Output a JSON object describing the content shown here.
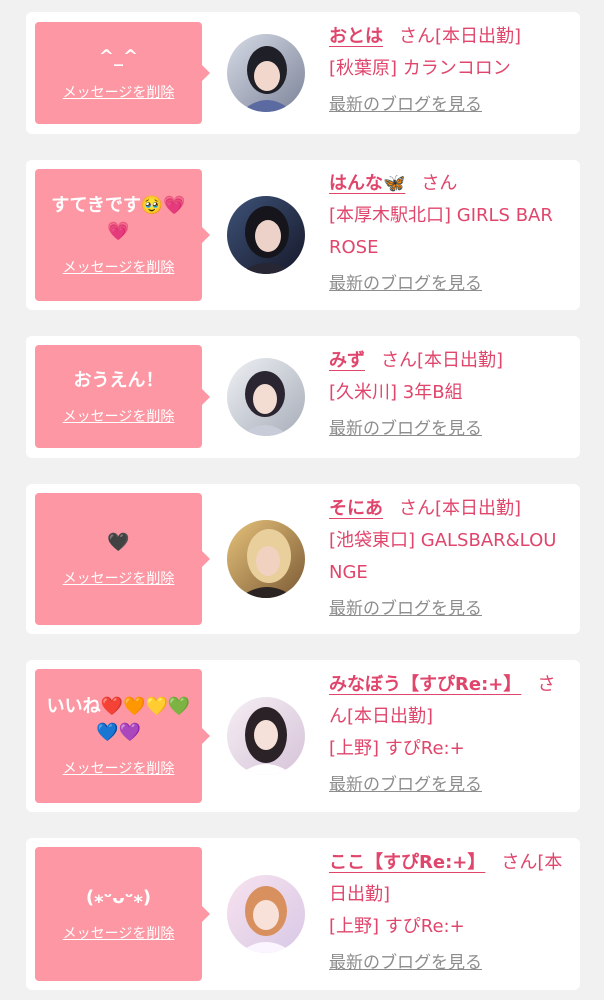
{
  "delete_label": "メッセージを削除",
  "blog_label": "最新のブログを見る",
  "honorific": "さん",
  "colors": {
    "accent": "#e0466c",
    "bubble": "#fd97a3",
    "link_gray": "#8d8d8d",
    "background": "#f1f1f1"
  },
  "entries": [
    {
      "message": "^_^",
      "name": "おとは",
      "status": "[本日出勤]",
      "shop": "[秋葉原] カランコロン"
    },
    {
      "message": "すてきです🥹💗💗",
      "name": "はんな🦋",
      "status": "",
      "shop": "[本厚木駅北口] GIRLS BAR ROSE"
    },
    {
      "message": "おうえん！",
      "name": "みず",
      "status": "[本日出勤]",
      "shop": "[久米川] 3年B組"
    },
    {
      "message": "🖤",
      "name": "そにあ",
      "status": "[本日出勤]",
      "shop": "[池袋東口] GALSBAR&LOUNGE"
    },
    {
      "message": "いいね❤️🧡💛💚💙💜",
      "name": "みなぼう【すぴRe:+】",
      "status": "[本日出勤]",
      "shop": "[上野] すぴRe:+"
    },
    {
      "message": "(⁎ᵕᴗᵕ⁎)",
      "name": "ここ【すぴRe:+】",
      "status": "[本日出勤]",
      "shop": "[上野] すぴRe:+"
    }
  ]
}
